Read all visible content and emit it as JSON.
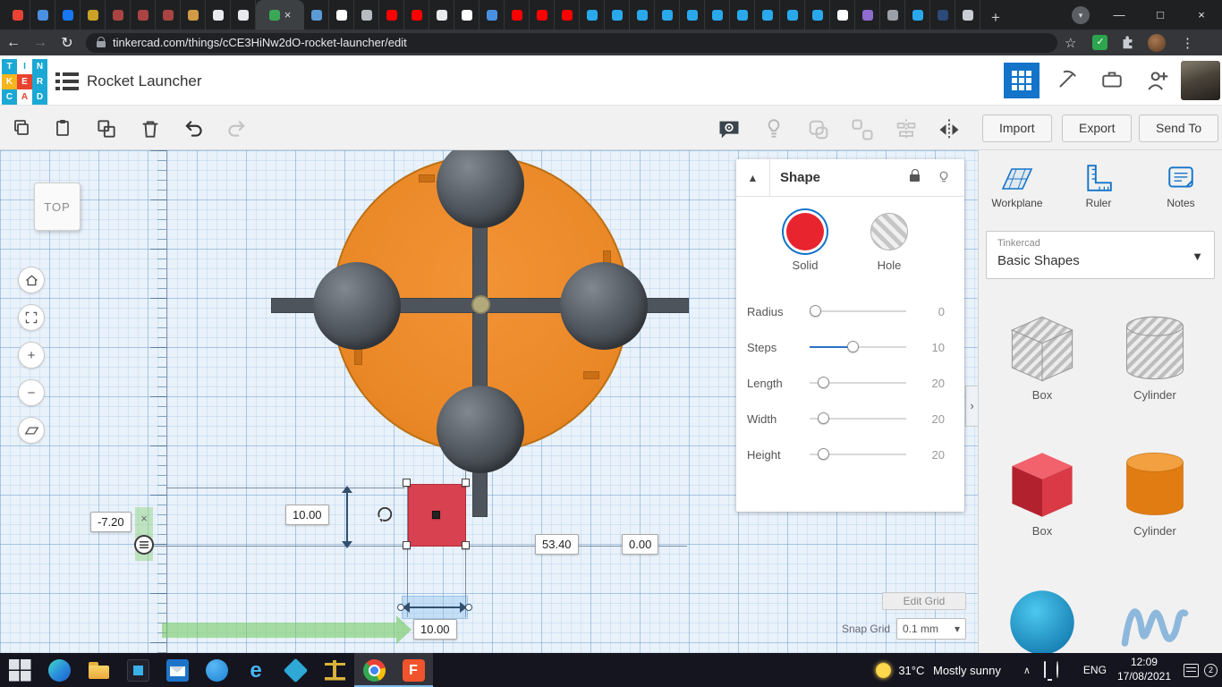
{
  "browser": {
    "url": "tinkercad.com/things/cCE3HiNw2dO-rocket-launcher/edit",
    "tabs": {
      "active_index": 10,
      "active_color": "#3aa757",
      "colors": [
        "#ea4335",
        "#4a90e2",
        "#1877f2",
        "#c9a227",
        "#a94442",
        "#a94442",
        "#a94442",
        "#d29a45",
        "#e8eaed",
        "#e8eaed",
        "#3aa757",
        "#5b9bd5",
        "#ffffff",
        "#b8bcc2",
        "#ff0000",
        "#ff0000",
        "#e8eaed",
        "#ffffff",
        "#4a90e2",
        "#ff0000",
        "#ff0000",
        "#ff0000",
        "#29a9eb",
        "#29a9eb",
        "#29a9eb",
        "#29a9eb",
        "#29a9eb",
        "#29a9eb",
        "#29a9eb",
        "#29a9eb",
        "#29a9eb",
        "#29a9eb",
        "#ffffff",
        "#8e6cd0",
        "#9aa0a6",
        "#29a9eb",
        "#2b4a77",
        "#c9ced4"
      ]
    }
  },
  "app_header": {
    "logo_rows": [
      [
        "T",
        "I",
        "N"
      ],
      [
        "K",
        "E",
        "R"
      ],
      [
        "C",
        "A",
        "D"
      ]
    ],
    "title": "Rocket Launcher"
  },
  "toolbar": {
    "import_label": "Import",
    "export_label": "Export",
    "send_to_label": "Send To"
  },
  "canvas": {
    "viewcube_label": "TOP",
    "dimensions": {
      "x_offset": "-7.20",
      "height": "10.00",
      "distance_right": "53.40",
      "distance_zero": "0.00",
      "width": "10.00"
    },
    "edit_grid_label": "Edit Grid",
    "snap_grid_label": "Snap Grid",
    "snap_grid_value": "0.1 mm"
  },
  "inspector": {
    "title": "Shape",
    "solid_label": "Solid",
    "hole_label": "Hole",
    "sliders": [
      {
        "label": "Radius",
        "value": "0"
      },
      {
        "label": "Steps",
        "value": "10"
      },
      {
        "label": "Length",
        "value": "20"
      },
      {
        "label": "Width",
        "value": "20"
      },
      {
        "label": "Height",
        "value": "20"
      }
    ]
  },
  "shapes_panel": {
    "tools": [
      {
        "label": "Workplane"
      },
      {
        "label": "Ruler"
      },
      {
        "label": "Notes"
      }
    ],
    "library_brand": "Tinkercad",
    "library_selected": "Basic Shapes",
    "shapes": [
      {
        "label": "Box",
        "variant": "hole"
      },
      {
        "label": "Cylinder",
        "variant": "hole"
      },
      {
        "label": "Box",
        "variant": "red"
      },
      {
        "label": "Cylinder",
        "variant": "orange"
      },
      {
        "label": "",
        "variant": "sphere"
      },
      {
        "label": "",
        "variant": "scribble"
      }
    ]
  },
  "taskbar": {
    "icons": [
      {
        "name": "start-button"
      },
      {
        "name": "edge-icon"
      },
      {
        "name": "file-explorer-icon"
      },
      {
        "name": "store-app-icon"
      },
      {
        "name": "mail-app-icon"
      },
      {
        "name": "skype-app-icon"
      },
      {
        "name": "edge-legacy-icon"
      },
      {
        "name": "diamond-app-icon"
      },
      {
        "name": "scales-app-icon"
      },
      {
        "name": "chrome-icon",
        "active": true
      },
      {
        "name": "tinkercad-app-icon",
        "active": true
      }
    ],
    "weather_temp": "31°C",
    "weather_desc": "Mostly sunny",
    "language": "ENG",
    "time": "12:09",
    "date": "17/08/2021",
    "notification_count": "2"
  }
}
